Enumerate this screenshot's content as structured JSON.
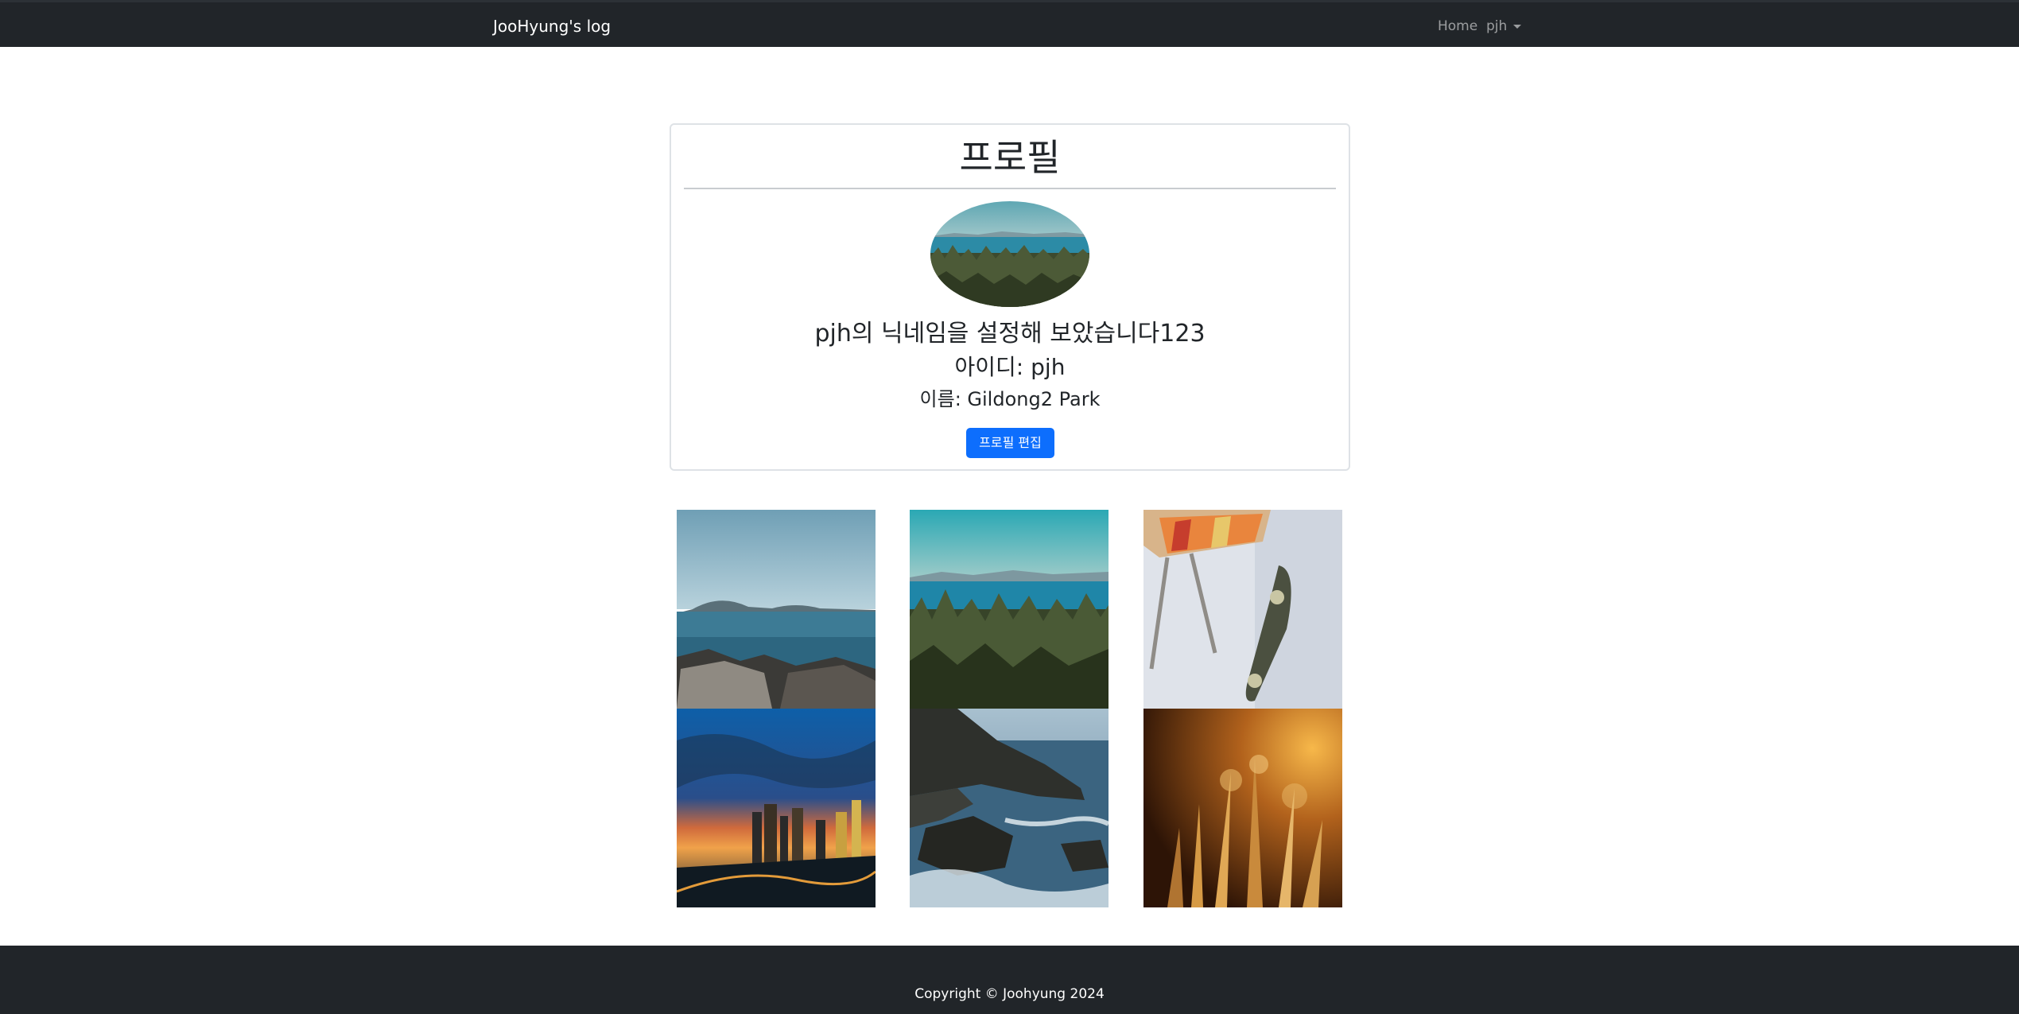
{
  "navbar": {
    "brand": "JooHyung's log",
    "home_label": "Home",
    "user_label": "pjh"
  },
  "profile": {
    "title": "프로필",
    "nickname": "pjh의 닉네임을 설정해 보았습니다123",
    "user_id": "아이디: pjh",
    "name": "이름: Gildong2 Park",
    "edit_button": "프로필 편집",
    "avatar_icon": "profile-image"
  },
  "gallery": {
    "photos": [
      "seaside-rocks-photo",
      "forest-lake-photo",
      "skateboard-photo",
      "city-sunset-photo",
      "coastal-cliffs-photo",
      "golden-grass-photo"
    ]
  },
  "footer": {
    "copyright": "Copyright © Joohyung 2024"
  },
  "colors": {
    "navbar_bg": "#212529",
    "primary": "#0d6efd",
    "footer_bg": "#212529"
  }
}
